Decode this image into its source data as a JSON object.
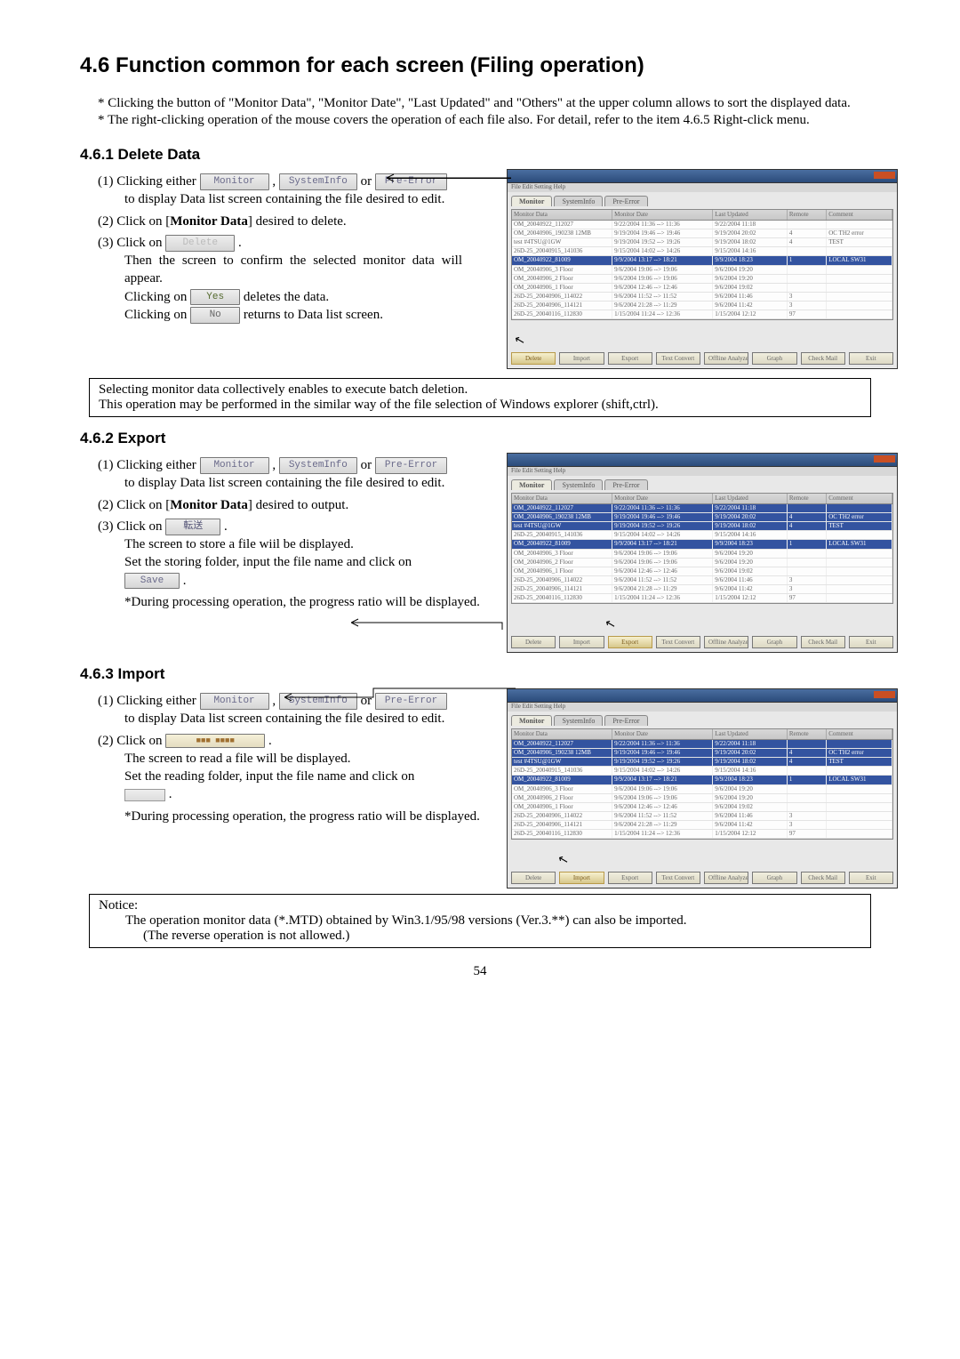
{
  "title": "4.6 Function common for each screen (Filing operation)",
  "intro": [
    "* Clicking the button of \"Monitor Data\", \"Monitor Date\", \"Last Updated\" and \"Others\" at the upper column allows to sort the displayed data.",
    "* The right-clicking operation of the mouse covers the operation of each file also. For detail, refer to the item 4.6.5 Right-click menu."
  ],
  "s461": {
    "title": "4.6.1 Delete Data",
    "p1a": "(1) Clicking either ",
    "p1b": " , ",
    "p1c": " or ",
    "p1d": " to display Data list screen containing the file desired to edit.",
    "p2a": "(2)  Click on [",
    "p2bold": "Monitor Data",
    "p2b": "] desired to delete.",
    "p3a": "(3)  Click on ",
    "p3b": " .",
    "p3c": "Then the screen to confirm the selected monitor data will appear.",
    "p3d": "Clicking on ",
    "p3e": " deletes the data.",
    "p3f": "Clicking on ",
    "p3g": " returns to Data list screen."
  },
  "noteA": "Selecting monitor data collectively enables to execute batch deletion.",
  "noteB": "This operation may be performed in the similar way of the file selection of Windows explorer (shift,ctrl).",
  "s462": {
    "title": "4.6.2 Export",
    "p1a": "(1) Clicking either ",
    "p1b": " , ",
    "p1c": " or ",
    "p1d": " to display Data list screen containing the file desired to edit.",
    "p2a": "(2) Click on [",
    "p2bold": "Monitor Data",
    "p2b": "] desired to output.",
    "p3a": "(3) Click on ",
    "p3b": " .",
    "p3c": "The screen to store a file wiil be displayed.",
    "p3d": "Set the storing folder, input the file name and click on ",
    "p3e": " .",
    "p3f": "*During processing operation, the progress ratio will be displayed."
  },
  "s463": {
    "title": "4.6.3 Import",
    "p1a": "(1) Clicking either ",
    "p1b": " , ",
    "p1c": " or ",
    "p1d": " to display Data list screen containing the file desired to edit.",
    "p2a": "(2) Click on ",
    "p2b": " .",
    "p2c": "The screen to read a file will be displayed.",
    "p2d": "Set the reading folder, input the file name and click on ",
    "p2e": " .",
    "p2f": "*During processing operation, the progress ratio will be displayed."
  },
  "buttons": {
    "monitor": "Monitor",
    "systeminfo": "SystemInfo",
    "preerror": "Pre-Error",
    "yes": "Yes",
    "no": "No",
    "delete": "Delete",
    "save": "Save",
    "export": "転送"
  },
  "grid_headers": [
    "Monitor Data",
    "Monitor Date",
    "Last Updated",
    "Remote",
    "Comment"
  ],
  "grid_rows_top": [
    [
      "OM_20040922_112027",
      "9/22/2004 11:36 --> 11:36",
      "9/22/2004 11:18",
      "",
      ""
    ],
    [
      "OM_20040906_190238 12MB",
      "9/19/2004 19:46 --> 19:46",
      "9/19/2004 20:02",
      "4",
      "OC TH2 error"
    ],
    [
      "test #4TSU@1GW",
      "9/19/2004 19:52 --> 19:26",
      "9/19/2004 18:02",
      "4",
      "TEST"
    ],
    [
      "26D-25_20040915_141036",
      "9/15/2004 14:02 --> 14:26",
      "9/15/2004 14:16",
      "",
      ""
    ]
  ],
  "grid_row_hl": [
    "OM_20040922_81009",
    "9/9/2004 13:17 --> 18:21",
    "9/9/2004 18:23",
    "1",
    "LOCAL SW31"
  ],
  "grid_rows_bottom": [
    [
      "OM_20040906_3 Floor",
      "9/6/2004 19:06 --> 19:06",
      "9/6/2004 19:20",
      "",
      ""
    ],
    [
      "OM_20040906_2 Floor",
      "9/6/2004 19:06 --> 19:06",
      "9/6/2004 19:20",
      "",
      ""
    ],
    [
      "OM_20040906_1 Floor",
      "9/6/2004 12:46 --> 12:46",
      "9/6/2004 19:02",
      "",
      ""
    ],
    [
      "26D-25_20040906_114022",
      "9/6/2004 11:52 --> 11:52",
      "9/6/2004 11:46",
      "3",
      ""
    ],
    [
      "26D-25_20040906_114121",
      "9/6/2004 21:28 --> 11:29",
      "9/6/2004 11:42",
      "3",
      ""
    ],
    [
      "26D-25_20040116_112830",
      "1/15/2004 11:24 --> 12:36",
      "1/15/2004 12:12",
      "97",
      ""
    ]
  ],
  "tabs": [
    "Monitor",
    "SystemInfo",
    "Pre-Error"
  ],
  "winbtns": [
    "Delete",
    "Import",
    "Export",
    "Text Convert",
    "Offline Analyze",
    "Graph",
    "Check Mail",
    "Exit"
  ],
  "notice": {
    "title": "Notice:",
    "line1": "The operation monitor data (*.MTD) obtained by Win3.1/95/98 versions (Ver.3.**) can also be imported.",
    "line2": "(The reverse operation is not allowed.)"
  },
  "page_num": "54"
}
